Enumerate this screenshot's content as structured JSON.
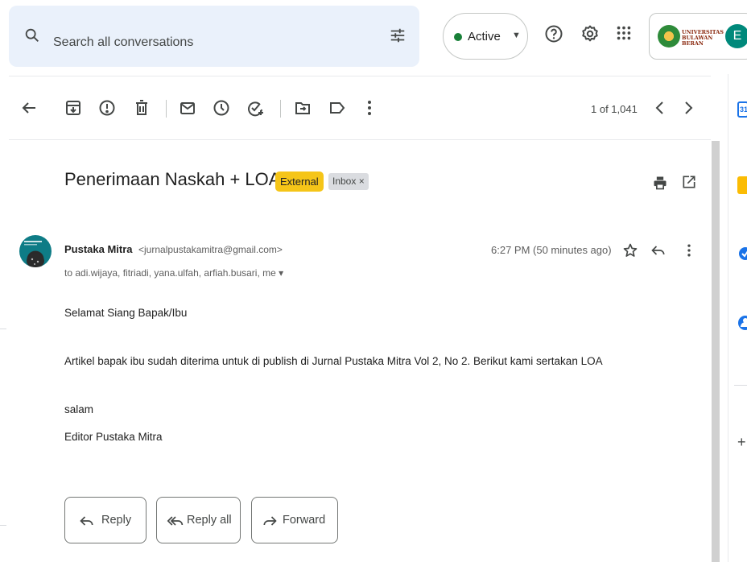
{
  "search": {
    "placeholder": "Search all conversations"
  },
  "status": {
    "label": "Active",
    "caret": "▼",
    "color": "#188038"
  },
  "account": {
    "org_name": "UNIVERSITAS BULAWAN BERAN",
    "avatar_letter": "E"
  },
  "toolbar": {
    "pager": "1 of 1,041"
  },
  "message": {
    "subject": "Penerimaan Naskah + LOA",
    "label_external": "External",
    "label_inbox": "Inbox ×",
    "sender_name": "Pustaka Mitra",
    "sender_email": "<jurnalpustakamitra@gmail.com>",
    "recipients": "to adi.wijaya, fitriadi, yana.ulfah, arfiah.busari, me ▾",
    "time": "6:27 PM (50 minutes ago)",
    "body": {
      "greeting": "Selamat Siang Bapak/Ibu",
      "paragraph": "Artikel bapak ibu sudah diterima untuk di publish di Jurnal Pustaka Mitra Vol 2, No 2. Berikut kami sertakan LOA",
      "closing": "salam",
      "signature": "Editor Pustaka Mitra"
    }
  },
  "actions": {
    "reply": "Reply",
    "reply_all": "Reply all",
    "forward": "Forward"
  },
  "side": {
    "calendar_day": "31",
    "add": "+"
  },
  "colors": {
    "accent": "#0b57d0",
    "external_tag": "#f5c518",
    "avatar": "#00897b"
  }
}
